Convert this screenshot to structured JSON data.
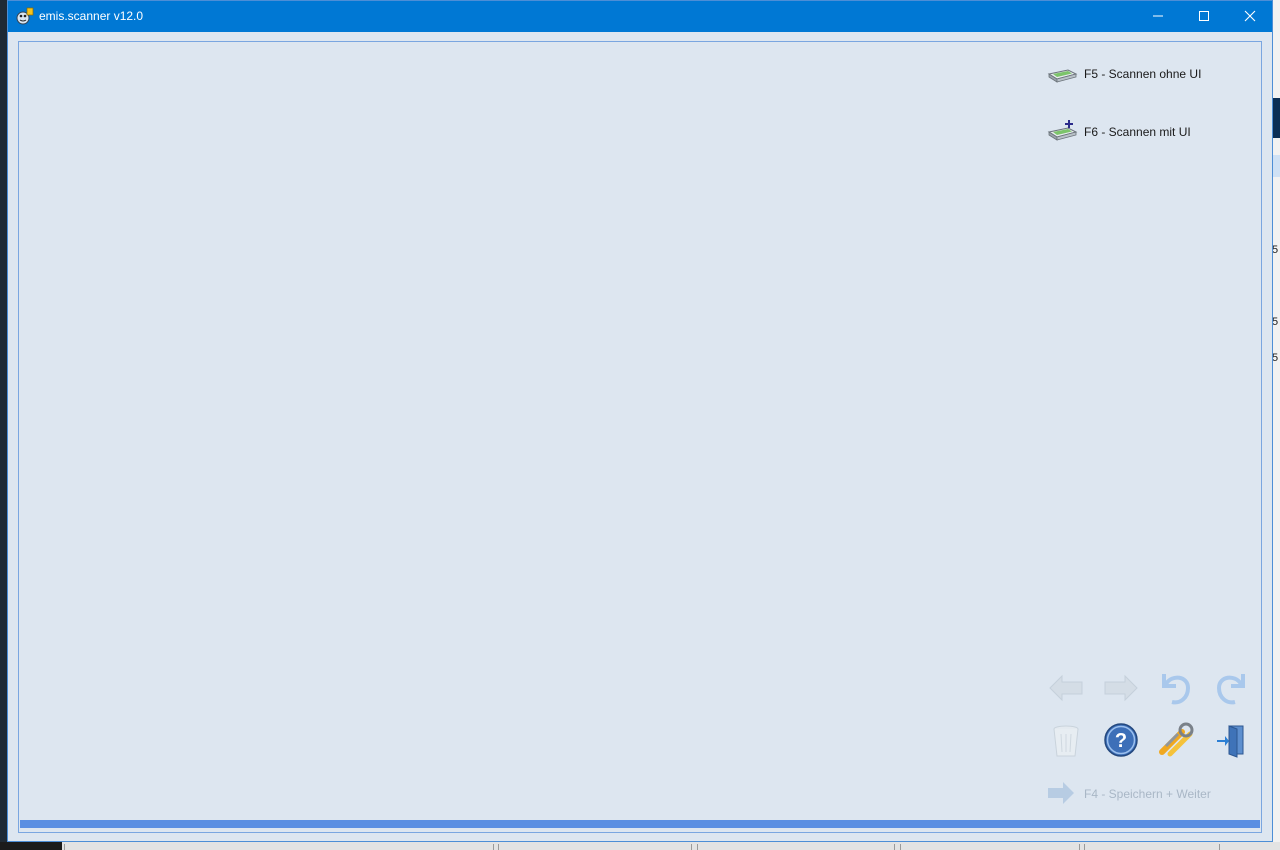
{
  "window": {
    "title": "emis.scanner v12.0",
    "controls": {
      "minimize_icon": "minimize-icon",
      "maximize_icon": "maximize-icon",
      "close_icon": "close-icon"
    }
  },
  "scan_actions": [
    {
      "label": "F5 - Scannen ohne UI",
      "icon": "scanner-icon"
    },
    {
      "label": "F6 - Scannen mit UI",
      "icon": "scanner-plus-icon"
    }
  ],
  "toolbar": {
    "row1": [
      "back-arrow-icon",
      "forward-arrow-icon",
      "rotate-left-icon",
      "rotate-right-icon"
    ],
    "row2": [
      "trash-icon",
      "help-icon",
      "settings-tools-icon",
      "exit-door-icon"
    ]
  },
  "save_next": {
    "label": "F4 - Speichern + Weiter",
    "icon": "arrow-right-icon"
  },
  "progress": {
    "value": 1.0
  },
  "background_app_digits": [
    "5",
    "5",
    "5"
  ],
  "colors": {
    "titlebar": "#0078d4",
    "window_bg": "#dde6f0",
    "progress": "#5b8fe2",
    "disabled_text": "#a9b7c6"
  }
}
